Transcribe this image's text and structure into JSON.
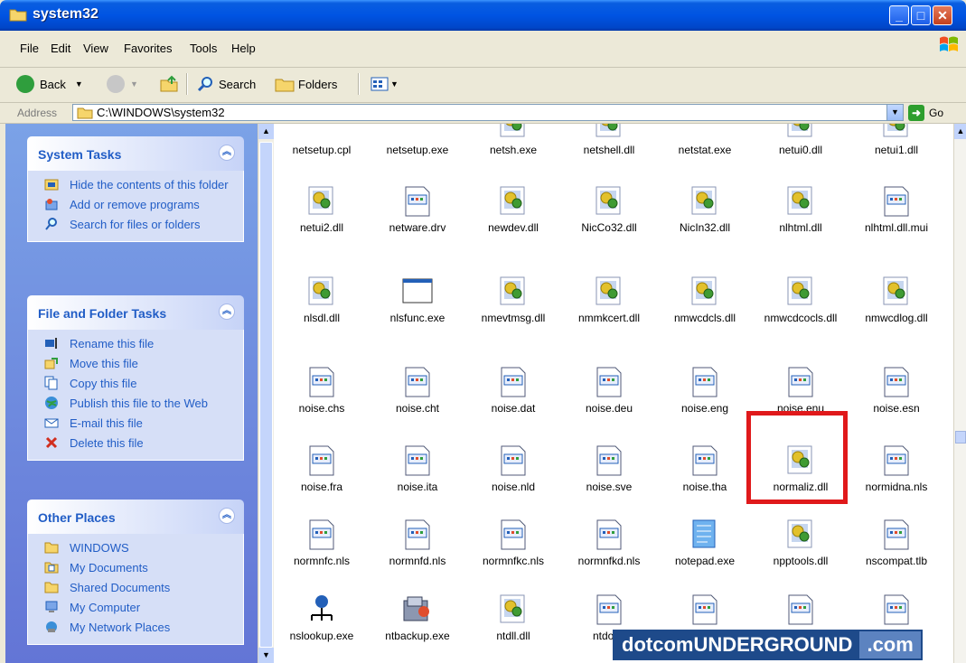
{
  "window": {
    "title": "system32"
  },
  "menu": [
    "File",
    "Edit",
    "View",
    "Favorites",
    "Tools",
    "Help"
  ],
  "toolbar": {
    "back": "Back",
    "search": "Search",
    "folders": "Folders"
  },
  "address": {
    "label": "Address",
    "path": "C:\\WINDOWS\\system32",
    "go": "Go"
  },
  "panels": [
    {
      "title": "System Tasks",
      "items": [
        {
          "label": "Hide the contents of this folder",
          "icon": "hide-folder-icon"
        },
        {
          "label": "Add or remove programs",
          "icon": "add-remove-icon"
        },
        {
          "label": "Search for files or folders",
          "icon": "search-icon"
        }
      ]
    },
    {
      "title": "File and Folder Tasks",
      "items": [
        {
          "label": "Rename this file",
          "icon": "rename-icon"
        },
        {
          "label": "Move this file",
          "icon": "move-icon"
        },
        {
          "label": "Copy this file",
          "icon": "copy-icon"
        },
        {
          "label": "Publish this file to the Web",
          "icon": "publish-icon"
        },
        {
          "label": "E-mail this file",
          "icon": "email-icon"
        },
        {
          "label": "Delete this file",
          "icon": "delete-icon"
        }
      ]
    },
    {
      "title": "Other Places",
      "items": [
        {
          "label": "WINDOWS",
          "icon": "folder-icon"
        },
        {
          "label": "My Documents",
          "icon": "my-documents-icon"
        },
        {
          "label": "Shared Documents",
          "icon": "folder-icon"
        },
        {
          "label": "My Computer",
          "icon": "my-computer-icon"
        },
        {
          "label": "My Network Places",
          "icon": "network-places-icon"
        }
      ]
    }
  ],
  "files": [
    [
      "netsetup.cpl",
      "netsetup.exe",
      "netsh.exe",
      "netshell.dll",
      "netstat.exe",
      "netui0.dll",
      "netui1.dll"
    ],
    [
      "netui2.dll",
      "netware.drv",
      "newdev.dll",
      "NicCo32.dll",
      "NicIn32.dll",
      "nlhtml.dll",
      "nlhtml.dll.mui"
    ],
    [
      "nlsdl.dll",
      "nlsfunc.exe",
      "nmevtmsg.dll",
      "nmmkcert.dll",
      "nmwcdcls.dll",
      "nmwcdcocls.dll",
      "nmwcdlog.dll"
    ],
    [
      "noise.chs",
      "noise.cht",
      "noise.dat",
      "noise.deu",
      "noise.eng",
      "noise.enu",
      "noise.esn"
    ],
    [
      "noise.fra",
      "noise.ita",
      "noise.nld",
      "noise.sve",
      "noise.tha",
      "normaliz.dll",
      "normidna.nls"
    ],
    [
      "normnfc.nls",
      "normnfd.nls",
      "normnfkc.nls",
      "normnfkd.nls",
      "notepad.exe",
      "npptools.dll",
      "nscompat.tlb"
    ],
    [
      "nslookup.exe",
      "ntbackup.exe",
      "ntdll.dll",
      "ntdos4",
      "",
      "",
      ""
    ]
  ],
  "file_icons": [
    [
      "blank-doc-icon",
      "exe-icon",
      "dll-icon",
      "dll-icon",
      "blank-doc-icon",
      "dll-icon",
      "dll-icon"
    ],
    [
      "dll-icon",
      "data-file-icon",
      "dll-icon",
      "dll-icon",
      "dll-icon",
      "dll-icon",
      "data-file-icon"
    ],
    [
      "dll-icon",
      "window-exe-icon",
      "dll-icon",
      "dll-icon",
      "dll-icon",
      "dll-icon",
      "dll-icon"
    ],
    [
      "data-file-icon",
      "data-file-icon",
      "data-file-icon",
      "data-file-icon",
      "data-file-icon",
      "data-file-icon",
      "data-file-icon"
    ],
    [
      "data-file-icon",
      "data-file-icon",
      "data-file-icon",
      "data-file-icon",
      "data-file-icon",
      "dll-icon",
      "data-file-icon"
    ],
    [
      "data-file-icon",
      "data-file-icon",
      "data-file-icon",
      "data-file-icon",
      "notepad-icon",
      "dll-icon",
      "data-file-icon"
    ],
    [
      "network-lookup-icon",
      "backup-icon",
      "dll-icon",
      "data-file-icon",
      "data-file-icon",
      "data-file-icon",
      "data-file-icon"
    ]
  ],
  "highlighted_file": "normaliz.dll",
  "watermark": {
    "main": "dotcomUNDERGROUND",
    "suffix": ".com"
  },
  "colors": {
    "title_bar": "#0054e3",
    "task_link": "#215dc6",
    "highlight": "#e0191b"
  }
}
